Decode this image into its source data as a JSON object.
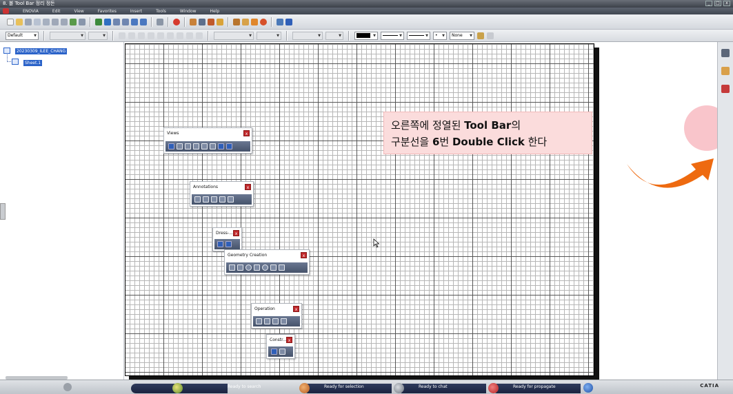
{
  "window": {
    "title": "8. 볼 Tool Bar 정리 정돈",
    "controls": [
      "_",
      "□",
      "x"
    ]
  },
  "menu": {
    "items": [
      "ENOVIA",
      "Edit",
      "View",
      "Favorites",
      "Insert",
      "Tools",
      "Window",
      "Help"
    ]
  },
  "format_toolbar": {
    "style_value": "Default",
    "line_type_value": "None"
  },
  "tree": {
    "root_label": "20230309_ILEE_CHANG",
    "child_label": "Sheet.1"
  },
  "toolbars": [
    {
      "title": "Views",
      "close": "x"
    },
    {
      "title": "Annotations",
      "close": "x"
    },
    {
      "title": "Dress-...",
      "close": "x"
    },
    {
      "title": "Geometry Creation",
      "close": "x"
    },
    {
      "title": "Operation",
      "close": "x"
    },
    {
      "title": "Constr...",
      "close": "x"
    }
  ],
  "callout": {
    "line1_a": "오른쪽에 정열된 ",
    "line1_b": "Tool Bar",
    "line1_c": "의",
    "line2_a": "구분선을 ",
    "line2_b": "6",
    "line2_c": "번 ",
    "line2_d": "Double Click",
    "line2_e": " 한다"
  },
  "statusbar": {
    "items": [
      "Ready to search",
      "Ready for selection",
      "Ready to chat",
      "Ready for propagate"
    ],
    "brand": "CATIA"
  },
  "colors": {
    "callout_bg": "#fbdcdc",
    "arrow": "#ee6a10",
    "selection": "#2b63c9",
    "toolbar_close": "#c0282b"
  }
}
